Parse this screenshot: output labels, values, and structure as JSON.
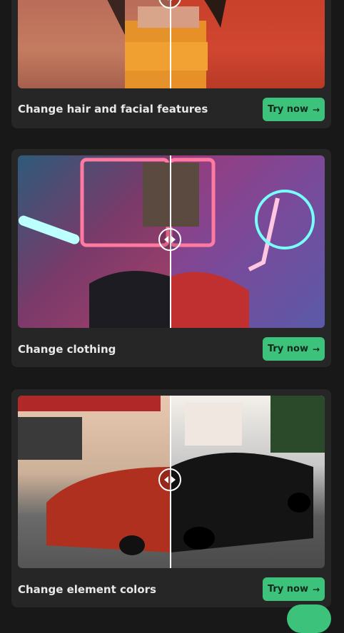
{
  "cards": [
    {
      "title": "Change hair and facial features",
      "button": "Try now"
    },
    {
      "title": "Change clothing",
      "button": "Try now"
    },
    {
      "title": "Change element colors",
      "button": "Try now"
    }
  ],
  "icons": {
    "arrow": "→"
  },
  "colors": {
    "accent": "#3cc27a",
    "card": "#262626",
    "background": "#181818"
  }
}
